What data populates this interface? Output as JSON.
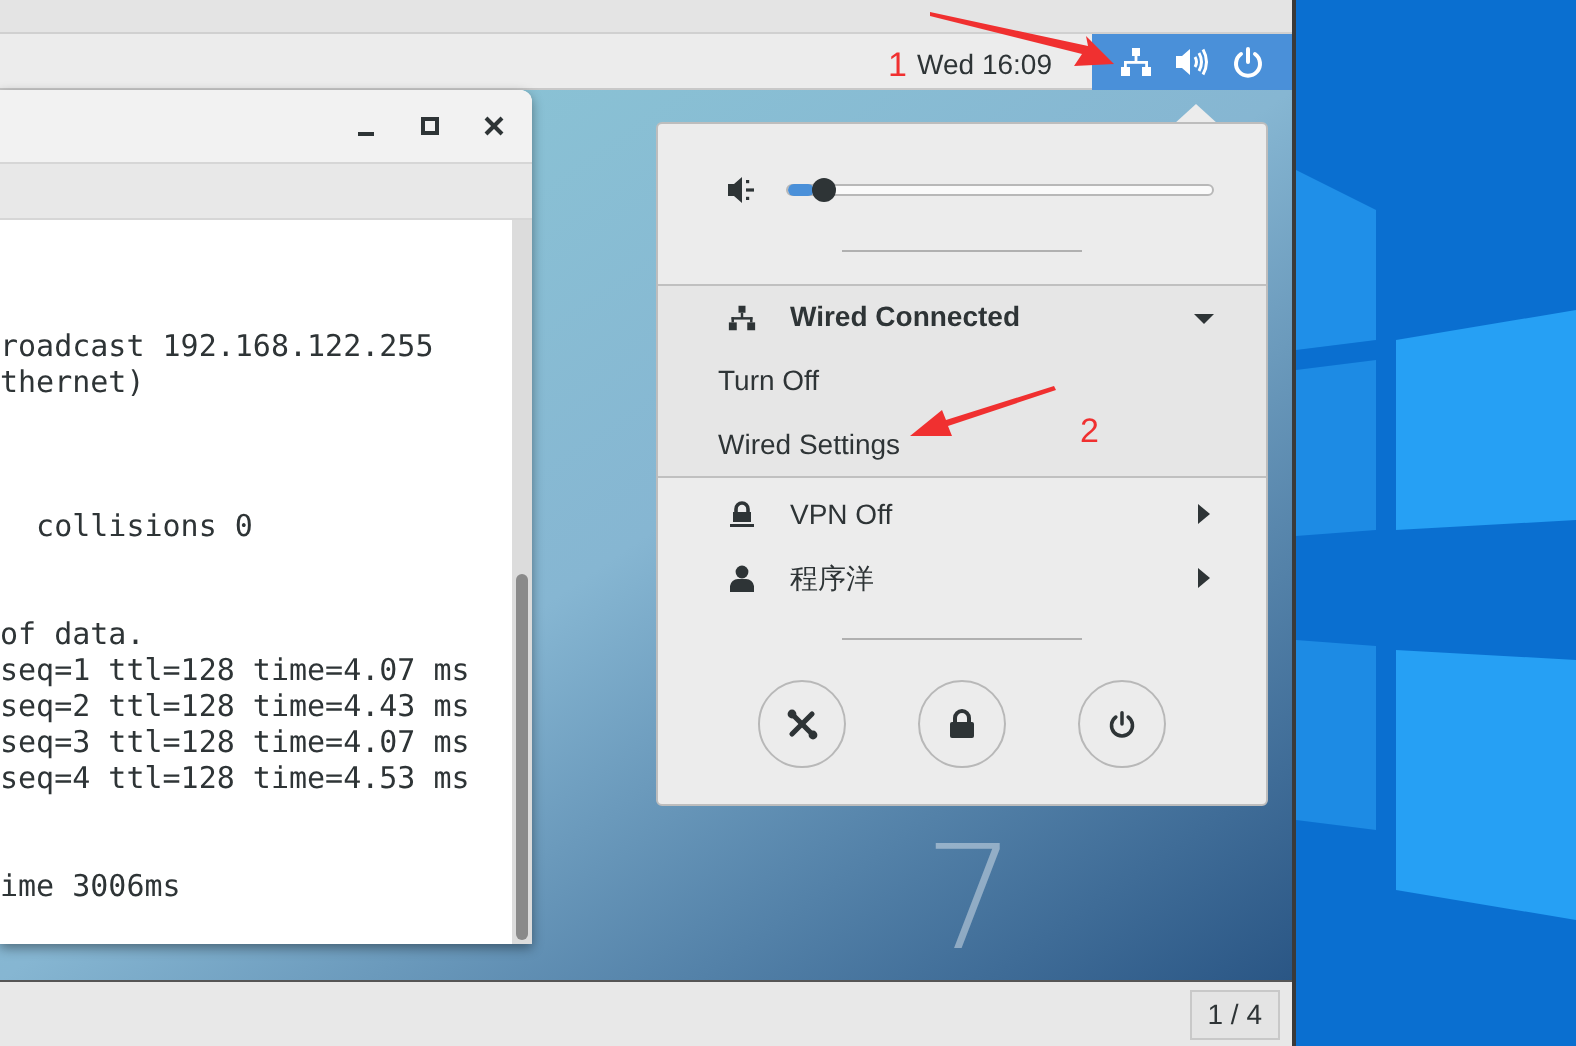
{
  "top_bar": {
    "clock": "Wed 16:09"
  },
  "terminal": {
    "blocks": [
      [
        "roadcast 192.168.122.255",
        "thernet)"
      ],
      [
        "  collisions 0"
      ],
      [
        "of data.",
        "seq=1 ttl=128 time=4.07 ms",
        "seq=2 ttl=128 time=4.43 ms",
        "seq=3 ttl=128 time=4.07 ms",
        "seq=4 ttl=128 time=4.53 ms"
      ],
      [
        "ime 3006ms"
      ]
    ]
  },
  "system_menu": {
    "volume": {
      "level": 0.06
    },
    "network": {
      "title": "Wired Connected",
      "expanded": true,
      "items": [
        "Turn Off",
        "Wired Settings"
      ]
    },
    "rows": [
      {
        "kind": "vpn",
        "label": "VPN Off"
      },
      {
        "kind": "user",
        "label": "程序洋"
      }
    ]
  },
  "wallpaper_mark": "7",
  "workspace_indicator": "1 / 4",
  "annotations": [
    {
      "label": "1"
    },
    {
      "label": "2"
    }
  ]
}
